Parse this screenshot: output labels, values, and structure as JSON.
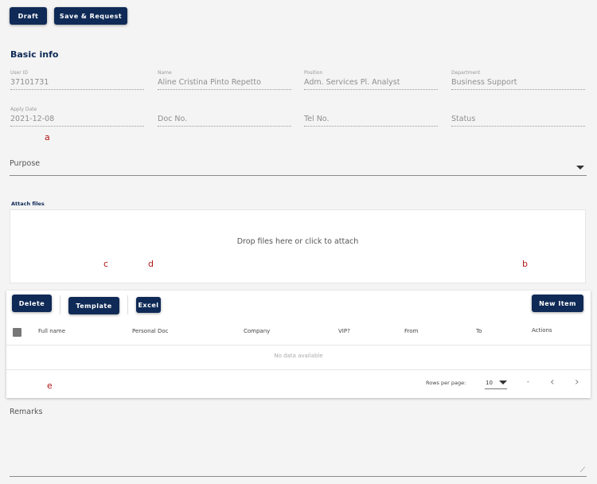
{
  "toolbar": {
    "draft_label": "Draft",
    "save_request_label": "Save & Request"
  },
  "basic_info": {
    "title": "Basic info",
    "fields": [
      {
        "label": "User ID",
        "value": "37101731"
      },
      {
        "label": "Name",
        "value": "Aline Cristina Pinto Repetto"
      },
      {
        "label": "Position",
        "value": "Adm. Services Pl. Analyst"
      },
      {
        "label": "Department",
        "value": "Business Support"
      },
      {
        "label": "Apply Date",
        "value": "2021-12-08"
      },
      {
        "label": "",
        "value": "Doc No."
      },
      {
        "label": "",
        "value": "Tel No."
      },
      {
        "label": "",
        "value": "Status"
      }
    ]
  },
  "purpose": {
    "placeholder": "Purpose"
  },
  "attach": {
    "label": "Attach files",
    "drop_text": "Drop files here or click to attach"
  },
  "table": {
    "delete_label": "Delete",
    "template_label": "Template",
    "excel_label": "Excel",
    "new_item_label": "New Item",
    "columns": [
      "Full name",
      "Personal Doc",
      "Company",
      "VIP?",
      "From",
      "To",
      "Actions"
    ],
    "empty_text": "No data available",
    "rows_per_page_label": "Rows per page:",
    "rows_per_page_value": "10",
    "range_text": "-"
  },
  "remarks": {
    "placeholder": "Remarks",
    "resize_glyph": "⟋"
  },
  "markers": {
    "a": "a",
    "b": "b",
    "c": "c",
    "d": "d",
    "e": "e"
  },
  "icons": {
    "prev": "‹",
    "next": "›"
  },
  "colors": {
    "brand": "#0f2a56",
    "marker": "#b11616"
  }
}
